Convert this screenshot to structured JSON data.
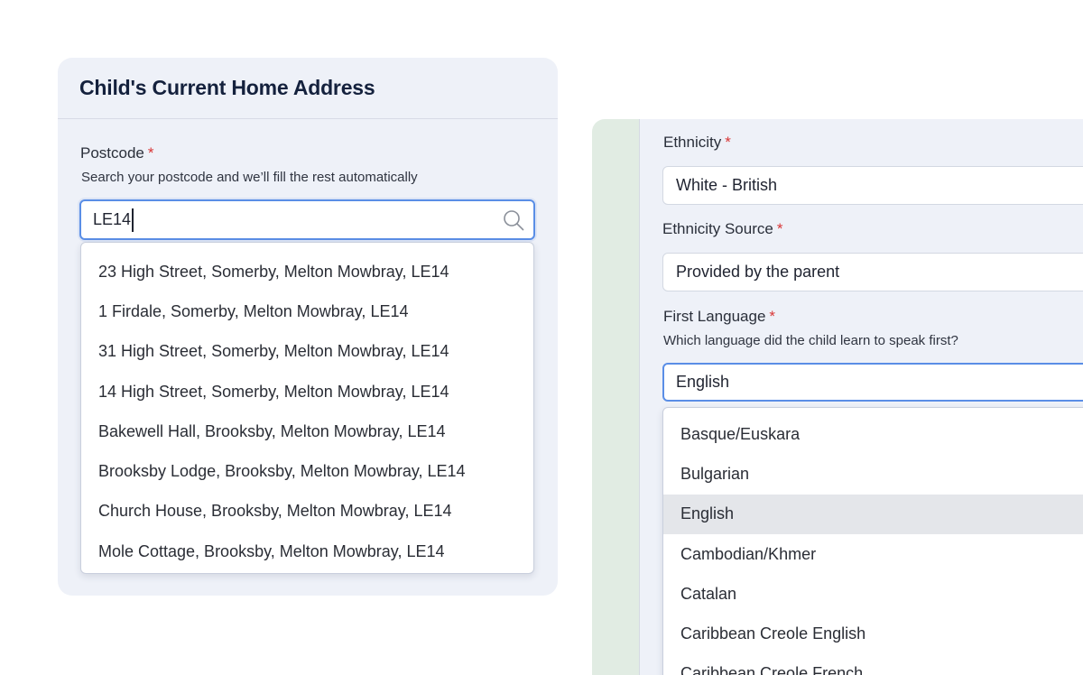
{
  "address_card": {
    "title": "Child's Current Home Address",
    "postcode": {
      "label": "Postcode",
      "required_mark": "*",
      "hint": "Search your postcode and we’ll fill the rest automatically",
      "value": "LE14",
      "results": [
        "23 High Street, Somerby, Melton Mowbray, LE14",
        "1 Firdale, Somerby, Melton Mowbray, LE14",
        "31 High Street, Somerby, Melton Mowbray, LE14",
        "14 High Street, Somerby, Melton Mowbray, LE14",
        "Bakewell Hall, Brooksby, Melton Mowbray, LE14",
        "Brooksby Lodge, Brooksby, Melton Mowbray, LE14",
        "Church House, Brooksby, Melton Mowbray, LE14",
        "Mole Cottage, Brooksby, Melton Mowbray, LE14"
      ]
    }
  },
  "details_panel": {
    "ethnicity": {
      "label": "Ethnicity",
      "required_mark": "*",
      "value": "White - British"
    },
    "ethnicity_source": {
      "label": "Ethnicity Source",
      "required_mark": "*",
      "value": "Provided by the parent"
    },
    "first_language": {
      "label": "First Language",
      "required_mark": "*",
      "hint": "Which language did the child learn to speak first?",
      "value": "English",
      "options": [
        "Basque/Euskara",
        "Bulgarian",
        "English",
        "Cambodian/Khmer",
        "Catalan",
        "Caribbean Creole English",
        "Caribbean Creole French"
      ],
      "selected_option": "English"
    }
  },
  "colors": {
    "accent_focus": "#5a8ee6",
    "required": "#d93636",
    "card_bg": "#eef1f8",
    "title_text": "#14213d",
    "selected_option_bg": "#e4e6ea",
    "side_strip": "#e1ece3"
  },
  "icons": {
    "postcode_search": "search-icon"
  }
}
